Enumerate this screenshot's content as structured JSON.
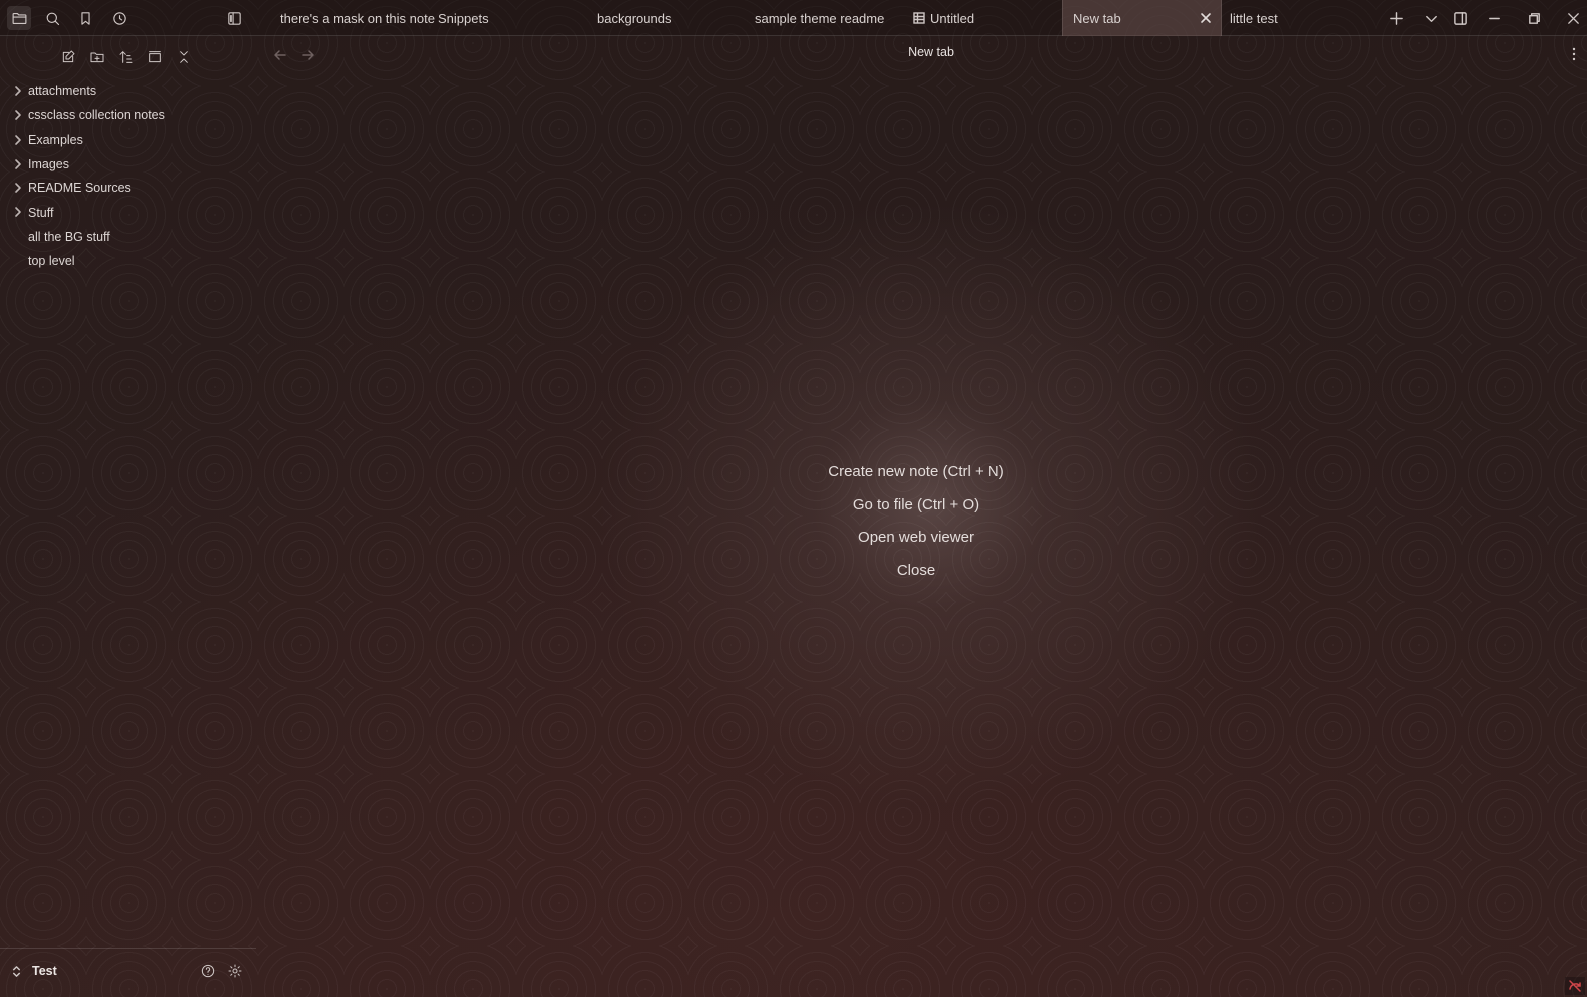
{
  "ribbon": {
    "icons": [
      "folder-icon",
      "search-icon",
      "bookmark-icon",
      "clock-icon",
      "sidebar-toggle-icon"
    ]
  },
  "tabs": [
    {
      "label": "there's a mask on this note"
    },
    {
      "label": "Snippets"
    },
    {
      "label": "backgrounds"
    },
    {
      "label": "sample theme readme"
    },
    {
      "label": "Untitled"
    },
    {
      "label": "New tab",
      "active": true
    },
    {
      "label": "little test"
    }
  ],
  "sidebar": {
    "tools": [
      "new-note-icon",
      "new-folder-icon",
      "sort-icon",
      "auto-reveal-icon",
      "collapse-all-icon"
    ],
    "tree": [
      {
        "label": "attachments",
        "folder": true
      },
      {
        "label": "cssclass collection notes",
        "folder": true
      },
      {
        "label": "Examples",
        "folder": true
      },
      {
        "label": "Images",
        "folder": true
      },
      {
        "label": "README Sources",
        "folder": true
      },
      {
        "label": "Stuff",
        "folder": true
      },
      {
        "label": "all the BG stuff",
        "folder": false
      },
      {
        "label": "top level",
        "folder": false
      }
    ],
    "vault_name": "Test"
  },
  "main": {
    "title": "New tab",
    "actions": [
      {
        "label": "Create new note (Ctrl + N)"
      },
      {
        "label": "Go to file (Ctrl + O)"
      },
      {
        "label": "Open web viewer"
      },
      {
        "label": "Close"
      }
    ]
  },
  "colors": {
    "background": "#2a1c1b",
    "active_tab": "#5a4544",
    "text": "#dcd6d4",
    "sync_error": "#d0464a"
  }
}
